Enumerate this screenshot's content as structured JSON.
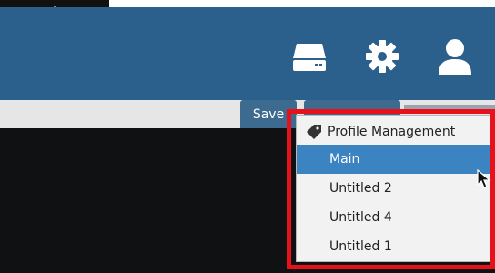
{
  "toolbar": {
    "save_label": "Save"
  },
  "profile_menu": {
    "header_label": "Profile Management",
    "items": [
      {
        "label": "Main",
        "selected": true
      },
      {
        "label": "Untitled 2",
        "selected": false
      },
      {
        "label": "Untitled 4",
        "selected": false
      },
      {
        "label": "Untitled 1",
        "selected": false
      }
    ]
  },
  "icons": {
    "header": [
      "drive-icon",
      "gear-icon",
      "user-icon"
    ],
    "menu_header": "tag-icon"
  },
  "colors": {
    "header_bg": "#2b5f8c",
    "selection": "#3b84c1",
    "highlight_box": "#e8111b"
  }
}
